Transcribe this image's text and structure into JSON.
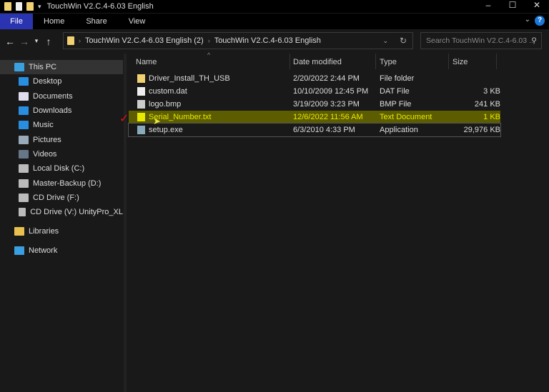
{
  "window": {
    "title": "TouchWin V2.C.4-6.03 English",
    "controls": [
      "–",
      "☐",
      "✕"
    ]
  },
  "ribbon": {
    "tabs": [
      "File",
      "Home",
      "Share",
      "View"
    ],
    "help": "?"
  },
  "address": {
    "crumbs": [
      "TouchWin V2.C.4-6.03 English (2)",
      "TouchWin V2.C.4-6.03 English"
    ]
  },
  "search": {
    "placeholder": "Search TouchWin V2.C.4-6.03 ..."
  },
  "sidebar": {
    "items": [
      {
        "label": "This PC",
        "icon": "computer-icon",
        "color": "#3aa0e0"
      },
      {
        "label": "Desktop",
        "icon": "desktop-icon",
        "color": "#2a8ee0"
      },
      {
        "label": "Documents",
        "icon": "documents-icon",
        "color": "#dde"
      },
      {
        "label": "Downloads",
        "icon": "downloads-icon",
        "color": "#2a8ee0"
      },
      {
        "label": "Music",
        "icon": "music-icon",
        "color": "#2a8ee0"
      },
      {
        "label": "Pictures",
        "icon": "pictures-icon",
        "color": "#9ab"
      },
      {
        "label": "Videos",
        "icon": "videos-icon",
        "color": "#678"
      },
      {
        "label": "Local Disk (C:)",
        "icon": "drive-icon",
        "color": "#bbb"
      },
      {
        "label": "Master-Backup (D:)",
        "icon": "drive-icon",
        "color": "#bbb"
      },
      {
        "label": "CD Drive (F:)",
        "icon": "cd-drive-icon",
        "color": "#bbb"
      },
      {
        "label": "CD Drive (V:) UnityPro_XL",
        "icon": "cd-drive-icon",
        "color": "#bbb"
      },
      {
        "label": "Libraries",
        "icon": "libraries-icon",
        "color": "#e8c050"
      },
      {
        "label": "Network",
        "icon": "network-icon",
        "color": "#3a9ee0"
      }
    ]
  },
  "columns": [
    "Name",
    "Date modified",
    "Type",
    "Size"
  ],
  "files": [
    {
      "name": "Driver_Install_TH_USB",
      "date": "2/20/2022 2:44 PM",
      "type": "File folder",
      "size": "",
      "icon": "folder-icon",
      "color": "#f0d070"
    },
    {
      "name": "custom.dat",
      "date": "10/10/2009 12:45 PM",
      "type": "DAT File",
      "size": "3 KB",
      "icon": "file-icon",
      "color": "#eee"
    },
    {
      "name": "logo.bmp",
      "date": "3/19/2009 3:23 PM",
      "type": "BMP File",
      "size": "241 KB",
      "icon": "image-file-icon",
      "color": "#ccc"
    },
    {
      "name": "Serial_Number.txt",
      "date": "12/6/2022 11:56 AM",
      "type": "Text Document",
      "size": "1 KB",
      "icon": "text-file-icon",
      "color": "#e8e800"
    },
    {
      "name": "setup.exe",
      "date": "6/3/2010 4:33 PM",
      "type": "Application",
      "size": "29,976 KB",
      "icon": "setup-icon",
      "color": "#8ab"
    }
  ]
}
